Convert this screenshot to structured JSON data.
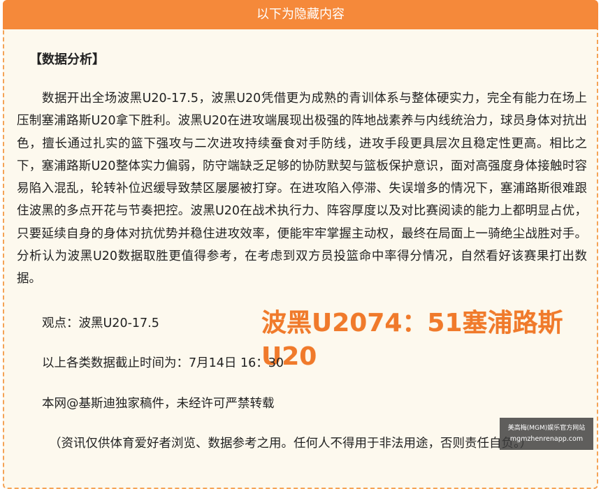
{
  "header": {
    "title": "以下为隐藏内容"
  },
  "section": {
    "title": "【数据分析】"
  },
  "body": {
    "paragraph": "数据开出全场波黑U20-17.5，波黑U20凭借更为成熟的青训体系与整体硬实力，完全有能力在场上压制塞浦路斯U20拿下胜利。波黑U20在进攻端展现出极强的阵地战素养与内线统治力，球员身体对抗出色，擅长通过扎实的篮下强攻与二次进攻持续蚕食对手防线，进攻手段更具层次且稳定性更高。相比之下，塞浦路斯U20整体实力偏弱，防守端缺乏足够的协防默契与篮板保护意识，面对高强度身体接触时容易陷入混乱，轮转补位迟缓导致禁区屡屡被打穿。在进攻陷入停滞、失误增多的情况下，塞浦路斯很难跟住波黑的多点开花与节奏把控。波黑U20在战术执行力、阵容厚度以及对比赛阅读的能力上都明显占优，只要延续自身的身体对抗优势并稳住进攻效率，便能牢牢掌握主动权，最终在局面上一骑绝尘战胜对手。分析认为波黑U20数据取胜更值得参考，在考虑到双方员投篮命中率得分情况，自然看好该赛果打出数据。",
    "viewpoint": "观点：波黑U20-17.5",
    "score": "波黑U2074：51塞浦路斯U20",
    "cutoff": "以上各类数据截止时间为：7月14日 16：30",
    "copyright": "本网@基斯迪独家稿件，未经许可严禁转载",
    "disclaimer": "（资讯仅供体育爱好者浏览、数据参考之用。任何人不得用于非法用途，否则责任自负。）"
  },
  "watermark": {
    "line1": "美高梅(MGM)娱乐官方网站",
    "line2": "mgmzhenrenapp.com"
  },
  "colors": {
    "header_bg": "#f5893a",
    "panel_bg": "#fdf9ee",
    "border": "#f5a356",
    "score": "#f07a2b"
  }
}
